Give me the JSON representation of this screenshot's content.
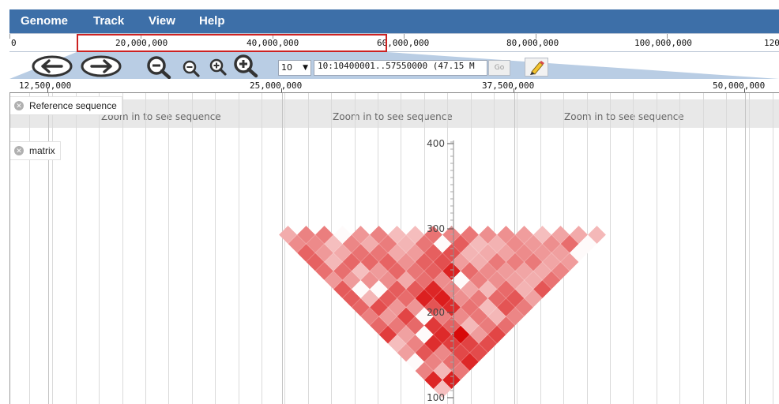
{
  "menubar": {
    "items": [
      "Genome",
      "Track",
      "View",
      "Help"
    ]
  },
  "overview_ruler": {
    "labels": [
      "0",
      "20,000,000",
      "40,000,000",
      "60,000,000",
      "80,000,000",
      "100,000,000",
      "120"
    ]
  },
  "navigation": {
    "icons": [
      "arrow-left-icon",
      "arrow-right-icon",
      "zoom-out-large-icon",
      "zoom-out-small-icon",
      "zoom-in-small-icon",
      "zoom-in-large-icon"
    ],
    "chromosome_select": "10",
    "location_value": "10:10400001..57550000 (47.15 M",
    "go_label": "Go",
    "highlight_icon": "pencil-highlight-icon"
  },
  "main_ruler": {
    "labels": [
      "12,500,000",
      "25,000,000",
      "37,500,000",
      "50,000,000"
    ]
  },
  "tracks": {
    "reference": {
      "label": "Reference sequence",
      "messages": [
        "Zoom in to see sequence",
        "Zoom in to see sequence",
        "Zoom in to see sequence"
      ]
    },
    "matrix": {
      "label": "matrix",
      "axis_labels": [
        "400",
        "300",
        "200",
        "100"
      ]
    }
  },
  "colors": {
    "menubar": "#3d6fa8",
    "highlight_box": "#cc2222",
    "heat_max": "#e00000",
    "heat_min": "#ffffff"
  }
}
